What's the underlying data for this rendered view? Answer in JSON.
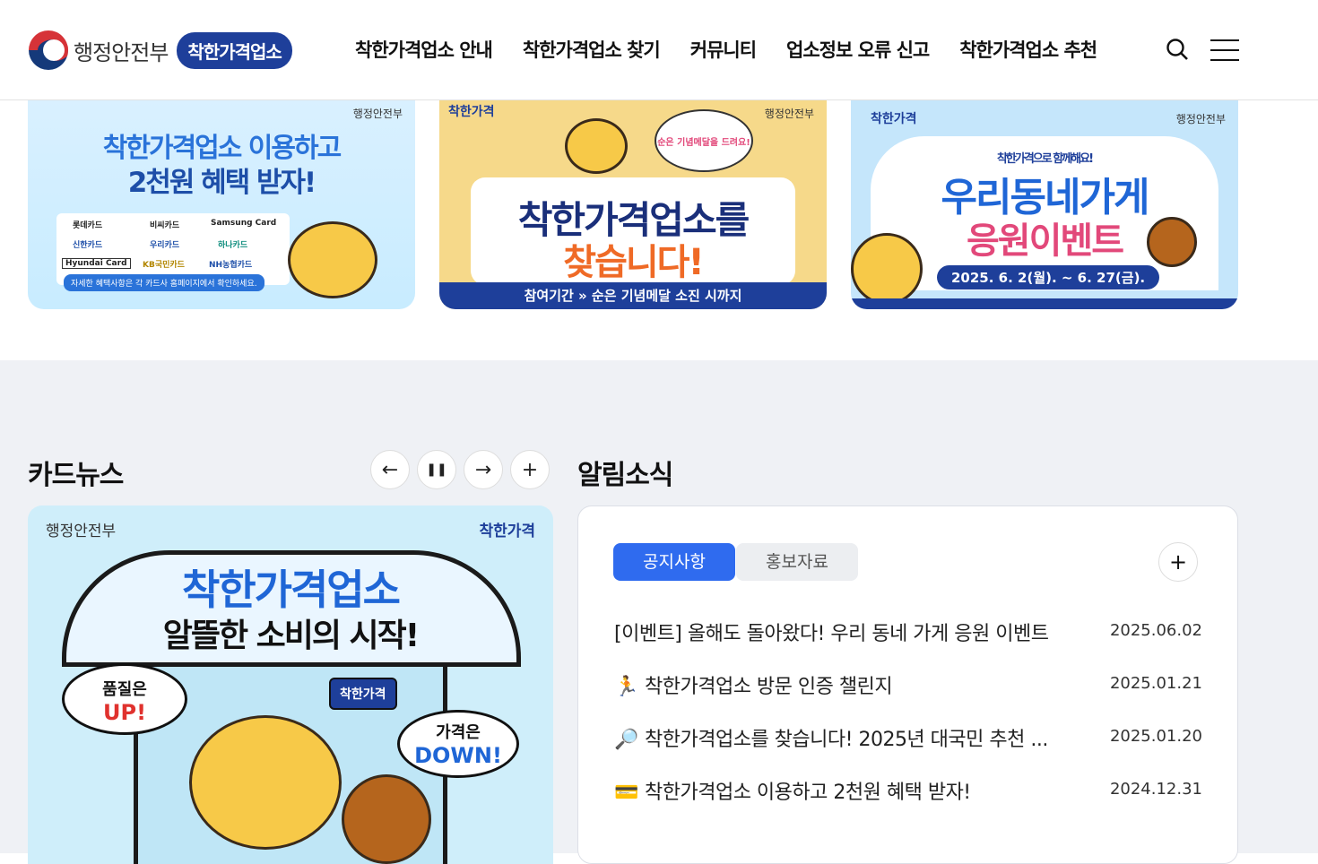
{
  "header": {
    "ministry": "행정안전부",
    "brand": "착한가격업소",
    "nav": [
      "착한가격업소 안내",
      "착한가격업소 찾기",
      "커뮤니티",
      "업소정보 오류 신고",
      "착한가격업소 추천"
    ],
    "icons": {
      "search": "search-icon",
      "menu": "hamburger-menu-icon"
    }
  },
  "banners": [
    {
      "gov": "행정안전부",
      "title1": "착한가격업소 이용하고",
      "title2": "2천원 혜택 받자!",
      "cards": [
        "롯데카드",
        "비씨카드",
        "Samsung Card",
        "신한카드",
        "우리카드",
        "하나카드",
        "Hyundai Card",
        "KB국민카드",
        "NH농협카드"
      ],
      "footnote": "자세한 혜택사항은 각 카드사 홈페이지에서 확인하세요."
    },
    {
      "gov": "행정안전부",
      "badge": "착한가격",
      "medal": "순은 기념메달을 드려요!",
      "title1": "착한가격업소를",
      "title2": "찾습니다!",
      "period": "참여기간 » 순은 기념메달 소진 시까지"
    },
    {
      "gov": "행정안전부",
      "badge": "착한가격",
      "sub": "착한가격으로 함께해요!",
      "title1": "우리동네가게",
      "title2": "응원이벤트",
      "date": "2025. 6. 2(월). ~ 6. 27(금)."
    }
  ],
  "cardnews": {
    "title": "카드뉴스",
    "controls": [
      "←",
      "❚❚",
      "→",
      "+"
    ],
    "gov": "행정안전부",
    "brand": "착한가격",
    "headline": "착한가격업소",
    "subline": "알뜰한 소비의 시작!",
    "bubble_left": [
      "품질은",
      "UP!"
    ],
    "bubble_right": [
      "가격은",
      "DOWN!"
    ],
    "sign": "착한가격"
  },
  "notices": {
    "title": "알림소식",
    "tabs": [
      "공지사항",
      "홍보자료"
    ],
    "plus": "+",
    "items": [
      {
        "icon": "",
        "title": "[이벤트] 올해도 돌아왔다! 우리 동네 가게 응원 이벤트",
        "date": "2025.06.02"
      },
      {
        "icon": "🏃",
        "title": "착한가격업소 방문 인증 챌린지",
        "date": "2025.01.21"
      },
      {
        "icon": "🔎",
        "title": "착한가격업소를 찾습니다! 2025년 대국민 추천 ...",
        "date": "2025.01.20"
      },
      {
        "icon": "💳",
        "title": "착한가격업소 이용하고 2천원 혜택 받자!",
        "date": "2024.12.31"
      }
    ]
  },
  "colors": {
    "brand_blue": "#1e3f9a",
    "accent_blue": "#2f6bef",
    "background_gray": "#eff1f5"
  }
}
